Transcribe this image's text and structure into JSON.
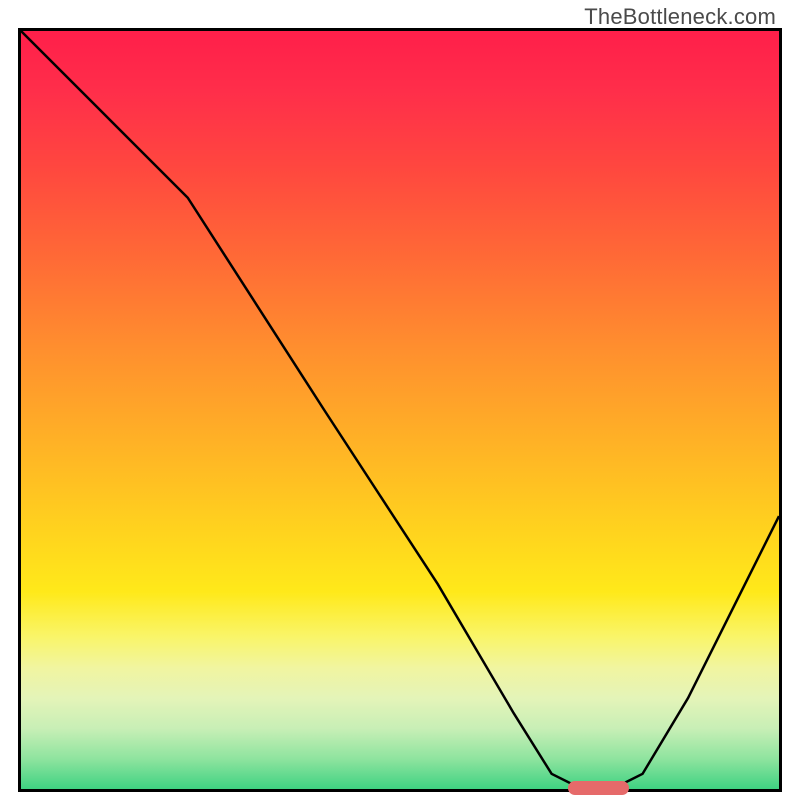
{
  "watermark": "TheBottleneck.com",
  "chart_data": {
    "type": "line",
    "title": "",
    "xlabel": "",
    "ylabel": "",
    "xlim": [
      0,
      100
    ],
    "ylim": [
      0,
      100
    ],
    "series": [
      {
        "name": "bottleneck-curve",
        "x": [
          0,
          10,
          22,
          40,
          55,
          65,
          70,
          74,
          78,
          82,
          88,
          94,
          100
        ],
        "y": [
          100,
          90,
          78,
          50,
          27,
          10,
          2,
          0,
          0,
          2,
          12,
          24,
          36
        ]
      }
    ],
    "marker": {
      "x_start": 72,
      "x_end": 80,
      "y": 0
    },
    "background_gradient": {
      "top": "#ff1f4a",
      "mid": "#ffd31e",
      "bottom": "#3fd282"
    }
  }
}
